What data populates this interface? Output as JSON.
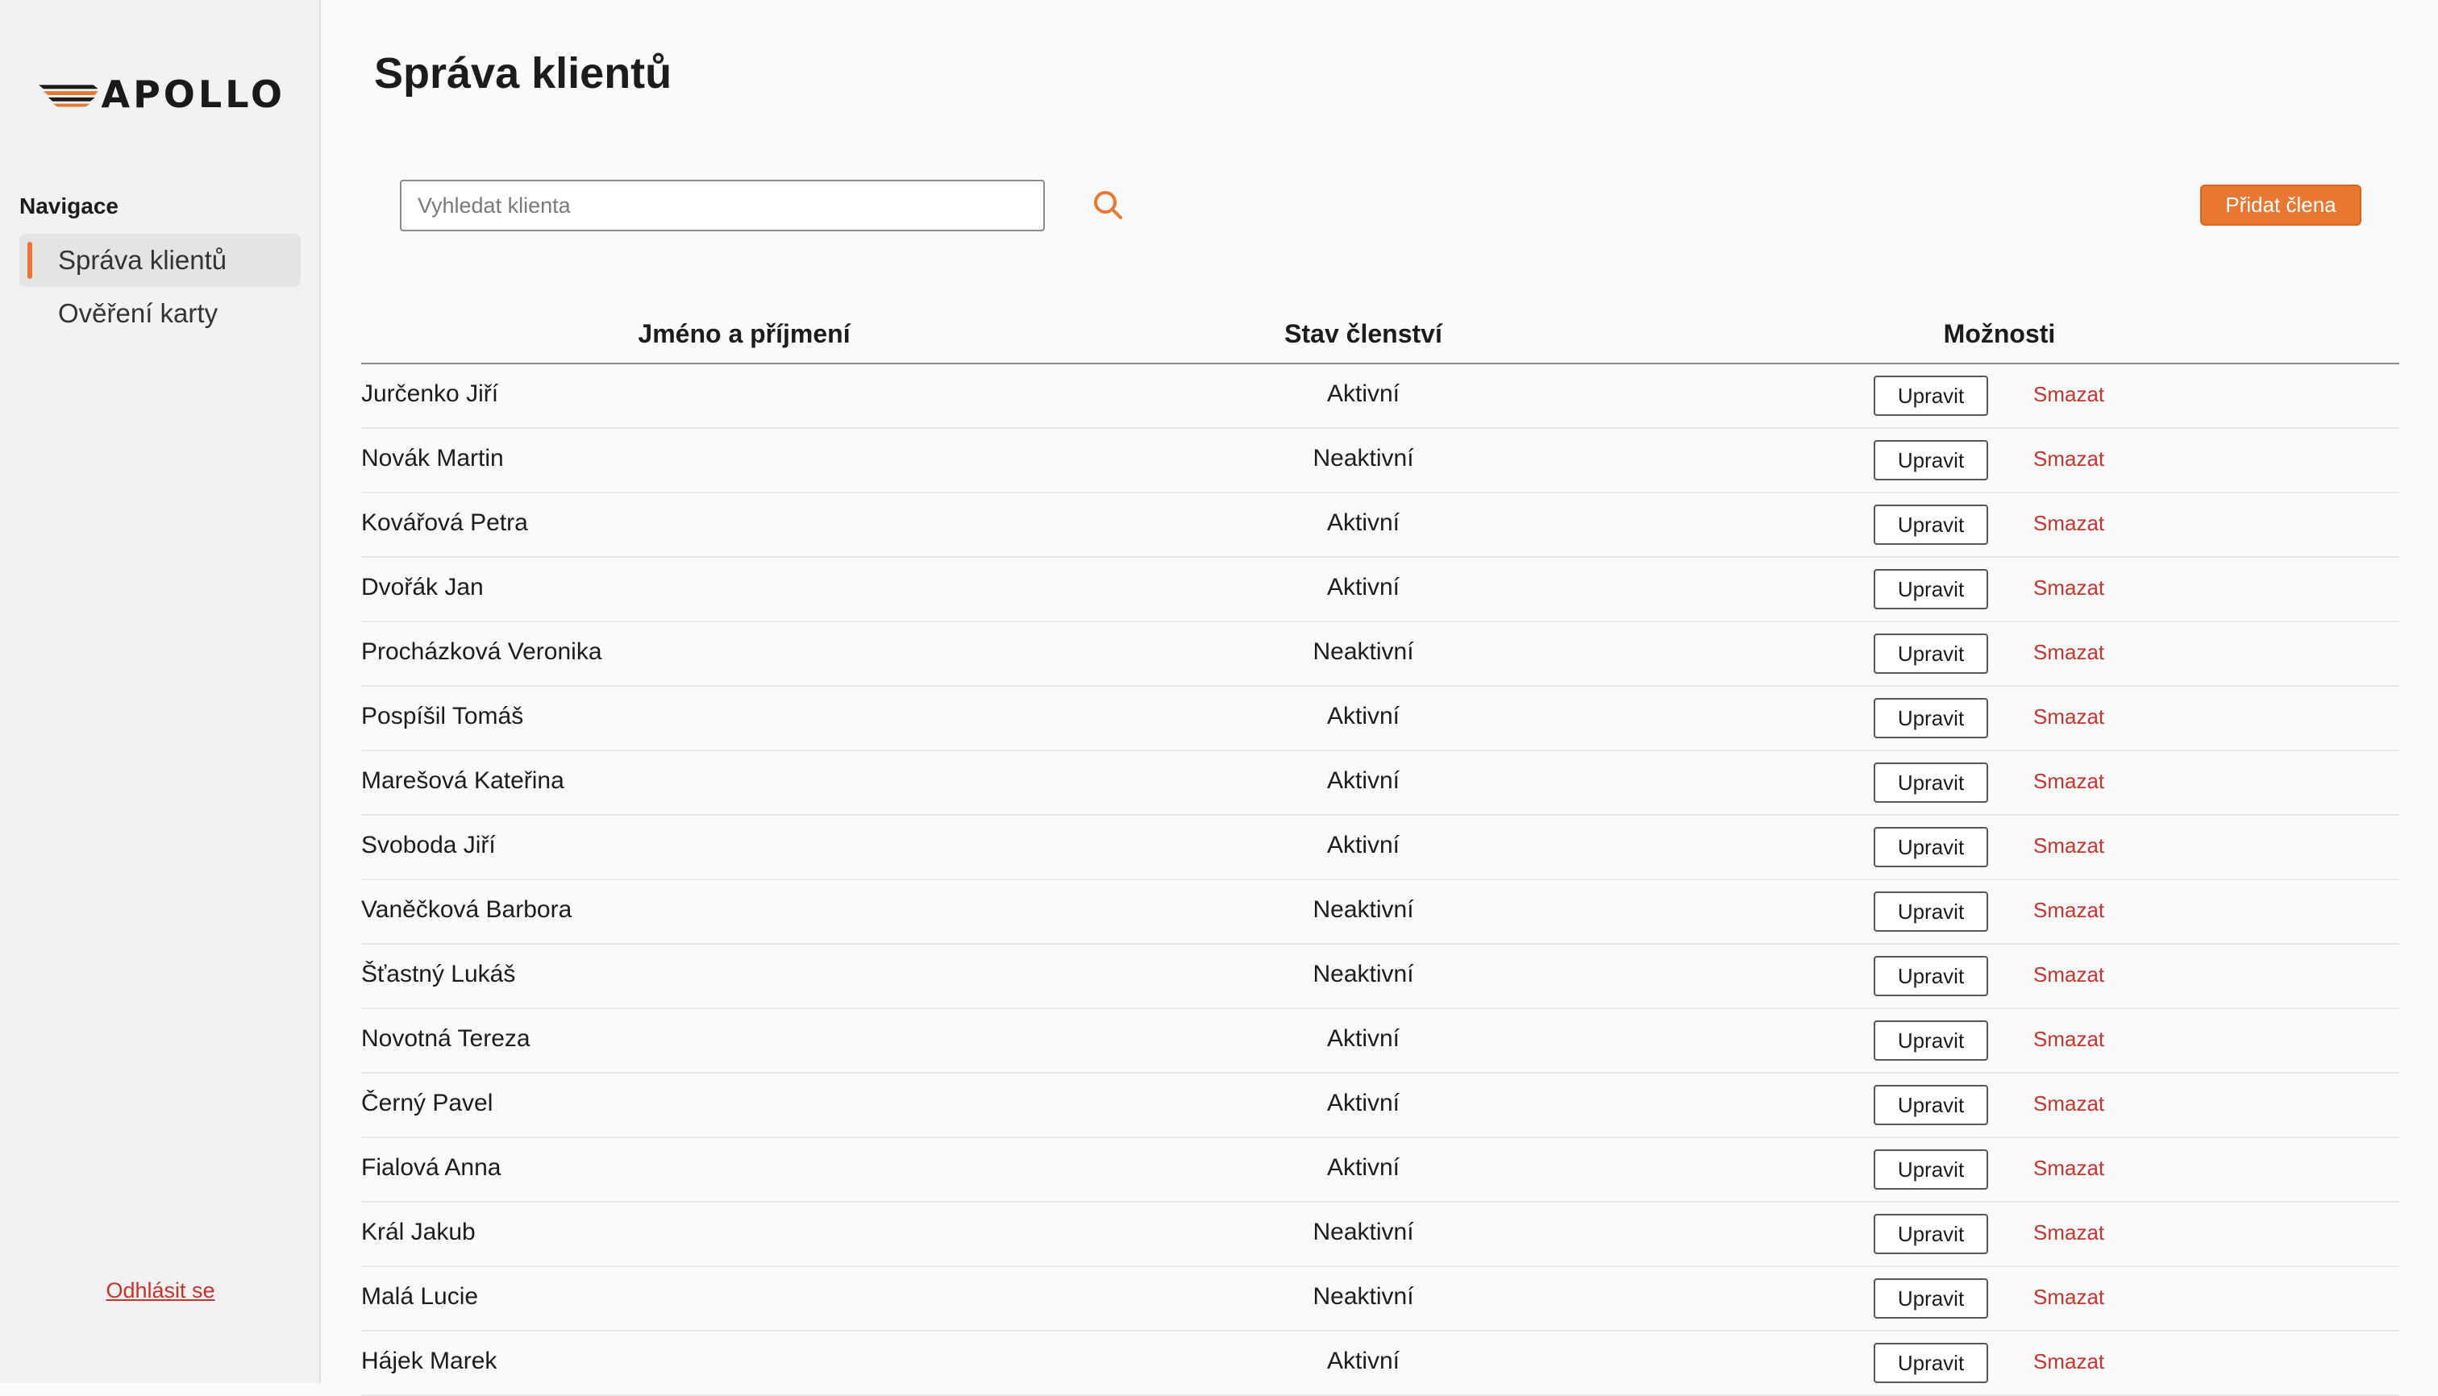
{
  "sidebar": {
    "logo_text": "APOLLO",
    "nav_title": "Navigace",
    "items": [
      {
        "label": "Správa klientů",
        "active": true
      },
      {
        "label": "Ověření karty",
        "active": false
      }
    ],
    "logout_label": "Odhlásit se"
  },
  "main": {
    "title": "Správa klientů",
    "search": {
      "placeholder": "Vyhledat klienta",
      "value": "",
      "icon": "search-icon"
    },
    "add_button_label": "Přidat člena",
    "table": {
      "headers": [
        "Jméno a příjmení",
        "Stav členství",
        "Možnosti"
      ],
      "edit_label": "Upravit",
      "delete_label": "Smazat",
      "rows": [
        {
          "name": "Jurčenko Jiří",
          "status": "Aktivní"
        },
        {
          "name": "Novák Martin",
          "status": "Neaktivní"
        },
        {
          "name": "Kovářová Petra",
          "status": "Aktivní"
        },
        {
          "name": "Dvořák Jan",
          "status": "Aktivní"
        },
        {
          "name": "Procházková Veronika",
          "status": "Neaktivní"
        },
        {
          "name": "Pospíšil Tomáš",
          "status": "Aktivní"
        },
        {
          "name": "Marešová Kateřina",
          "status": "Aktivní"
        },
        {
          "name": "Svoboda Jiří",
          "status": "Aktivní"
        },
        {
          "name": "Vaněčková Barbora",
          "status": "Neaktivní"
        },
        {
          "name": "Šťastný Lukáš",
          "status": "Neaktivní"
        },
        {
          "name": "Novotná Tereza",
          "status": "Aktivní"
        },
        {
          "name": "Černý Pavel",
          "status": "Aktivní"
        },
        {
          "name": "Fialová Anna",
          "status": "Aktivní"
        },
        {
          "name": "Král Jakub",
          "status": "Neaktivní"
        },
        {
          "name": "Malá Lucie",
          "status": "Neaktivní"
        },
        {
          "name": "Hájek Marek",
          "status": "Aktivní"
        }
      ]
    }
  },
  "colors": {
    "accent": "#e87731",
    "danger": "#c7332b",
    "sidebar_bg": "#f2f2f2",
    "page_bg": "#fafafa"
  }
}
